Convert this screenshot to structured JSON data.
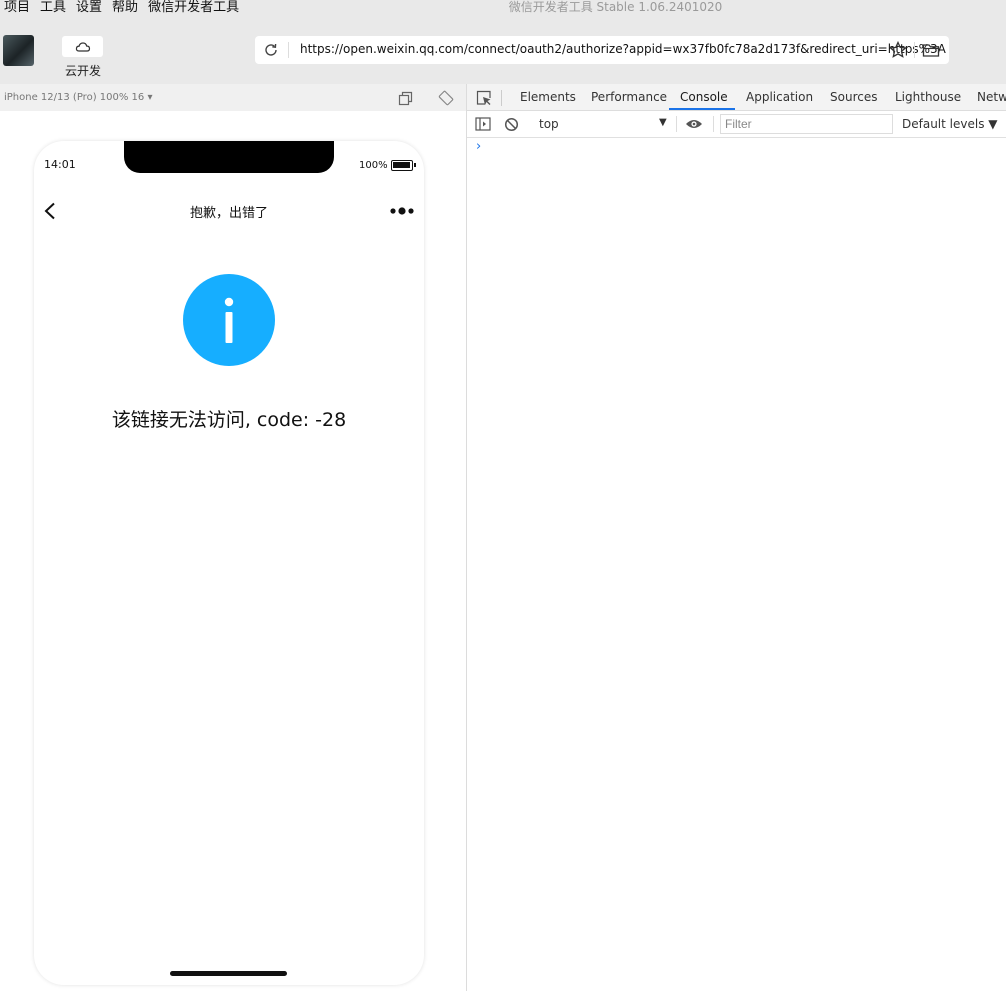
{
  "menubar": {
    "items": [
      "项目",
      "工具",
      "设置",
      "帮助",
      "微信开发者工具"
    ],
    "title": "微信开发者工具 Stable 1.06.2401020"
  },
  "toolbar": {
    "cloud_label": "云开发",
    "url": "https://open.weixin.qq.com/connect/oauth2/authorize?appid=wx37fb0fc78a2d173f&redirect_uri=https%3A"
  },
  "simulator": {
    "device": "iPhone 12/13 (Pro) 100% 16 ▾"
  },
  "phone": {
    "time": "14:01",
    "battery": "100%",
    "nav_title": "抱歉，出错了",
    "message": "该链接无法访问, code: -28",
    "accent_color": "#16aeff"
  },
  "devtools": {
    "tabs": [
      "Elements",
      "Performance",
      "Console",
      "Application",
      "Sources",
      "Lighthouse",
      "Netw"
    ],
    "active_tab": "Console",
    "context": "top",
    "filter_placeholder": "Filter",
    "levels": "Default levels ▼",
    "prompt": "›",
    "accent_color": "#1a73e8"
  }
}
